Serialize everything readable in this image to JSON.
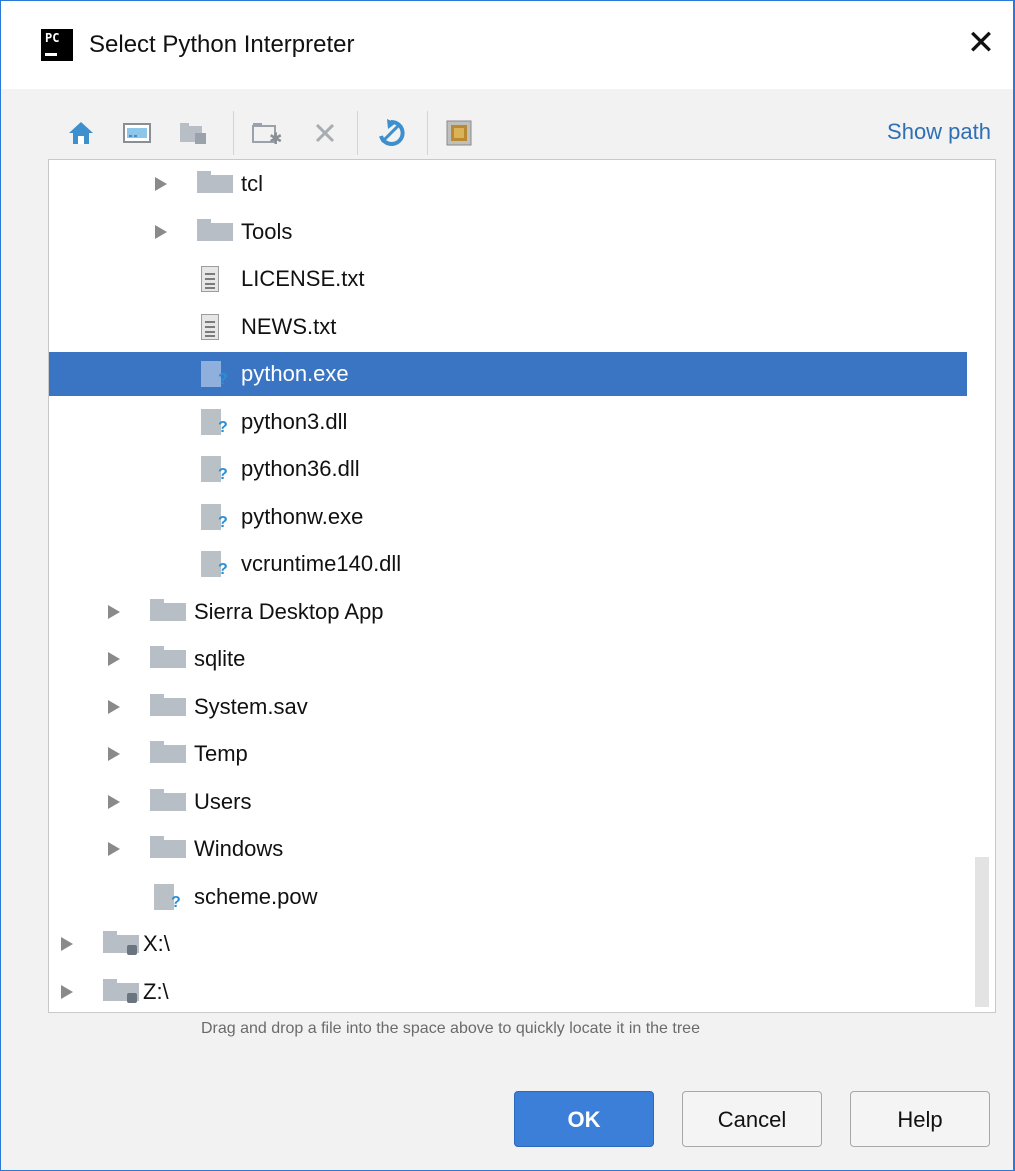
{
  "window": {
    "title": "Select Python Interpreter",
    "app_logo_text": "PC",
    "close_glyph": "✕"
  },
  "toolbar": {
    "buttons": [
      {
        "name": "home-icon"
      },
      {
        "name": "desktop-icon"
      },
      {
        "name": "project-folder-icon"
      },
      {
        "name": "new-folder-icon"
      },
      {
        "name": "delete-icon"
      },
      {
        "name": "refresh-icon"
      },
      {
        "name": "toggle-hidden-icon"
      }
    ],
    "show_path_label": "Show path"
  },
  "tree": {
    "rows": [
      {
        "label": "tcl",
        "type": "folder",
        "depth": 3,
        "expandable": true
      },
      {
        "label": "Tools",
        "type": "folder",
        "depth": 3,
        "expandable": true
      },
      {
        "label": "LICENSE.txt",
        "type": "text-file",
        "depth": 3,
        "expandable": false
      },
      {
        "label": "NEWS.txt",
        "type": "text-file",
        "depth": 3,
        "expandable": false
      },
      {
        "label": "python.exe",
        "type": "unknown-file",
        "depth": 3,
        "expandable": false,
        "selected": true
      },
      {
        "label": "python3.dll",
        "type": "unknown-file",
        "depth": 3,
        "expandable": false
      },
      {
        "label": "python36.dll",
        "type": "unknown-file",
        "depth": 3,
        "expandable": false
      },
      {
        "label": "pythonw.exe",
        "type": "unknown-file",
        "depth": 3,
        "expandable": false
      },
      {
        "label": "vcruntime140.dll",
        "type": "unknown-file",
        "depth": 3,
        "expandable": false
      },
      {
        "label": "Sierra Desktop App",
        "type": "folder",
        "depth": 2,
        "expandable": true
      },
      {
        "label": "sqlite",
        "type": "folder",
        "depth": 2,
        "expandable": true
      },
      {
        "label": "System.sav",
        "type": "folder",
        "depth": 2,
        "expandable": true
      },
      {
        "label": "Temp",
        "type": "folder",
        "depth": 2,
        "expandable": true
      },
      {
        "label": "Users",
        "type": "folder",
        "depth": 2,
        "expandable": true
      },
      {
        "label": "Windows",
        "type": "folder",
        "depth": 2,
        "expandable": true
      },
      {
        "label": "scheme.pow",
        "type": "unknown-file",
        "depth": 2,
        "expandable": false
      },
      {
        "label": "X:\\",
        "type": "drive",
        "depth": 1,
        "expandable": true
      },
      {
        "label": "Z:\\",
        "type": "drive",
        "depth": 1,
        "expandable": true
      }
    ]
  },
  "hint": "Drag and drop a file into the space above to quickly locate it in the tree",
  "buttons": {
    "ok": "OK",
    "cancel": "Cancel",
    "help": "Help"
  },
  "colors": {
    "selection": "#3a75c4",
    "accent_link": "#2e6fb5",
    "primary_button": "#3b7fd8",
    "window_border": "#2b79d7"
  }
}
